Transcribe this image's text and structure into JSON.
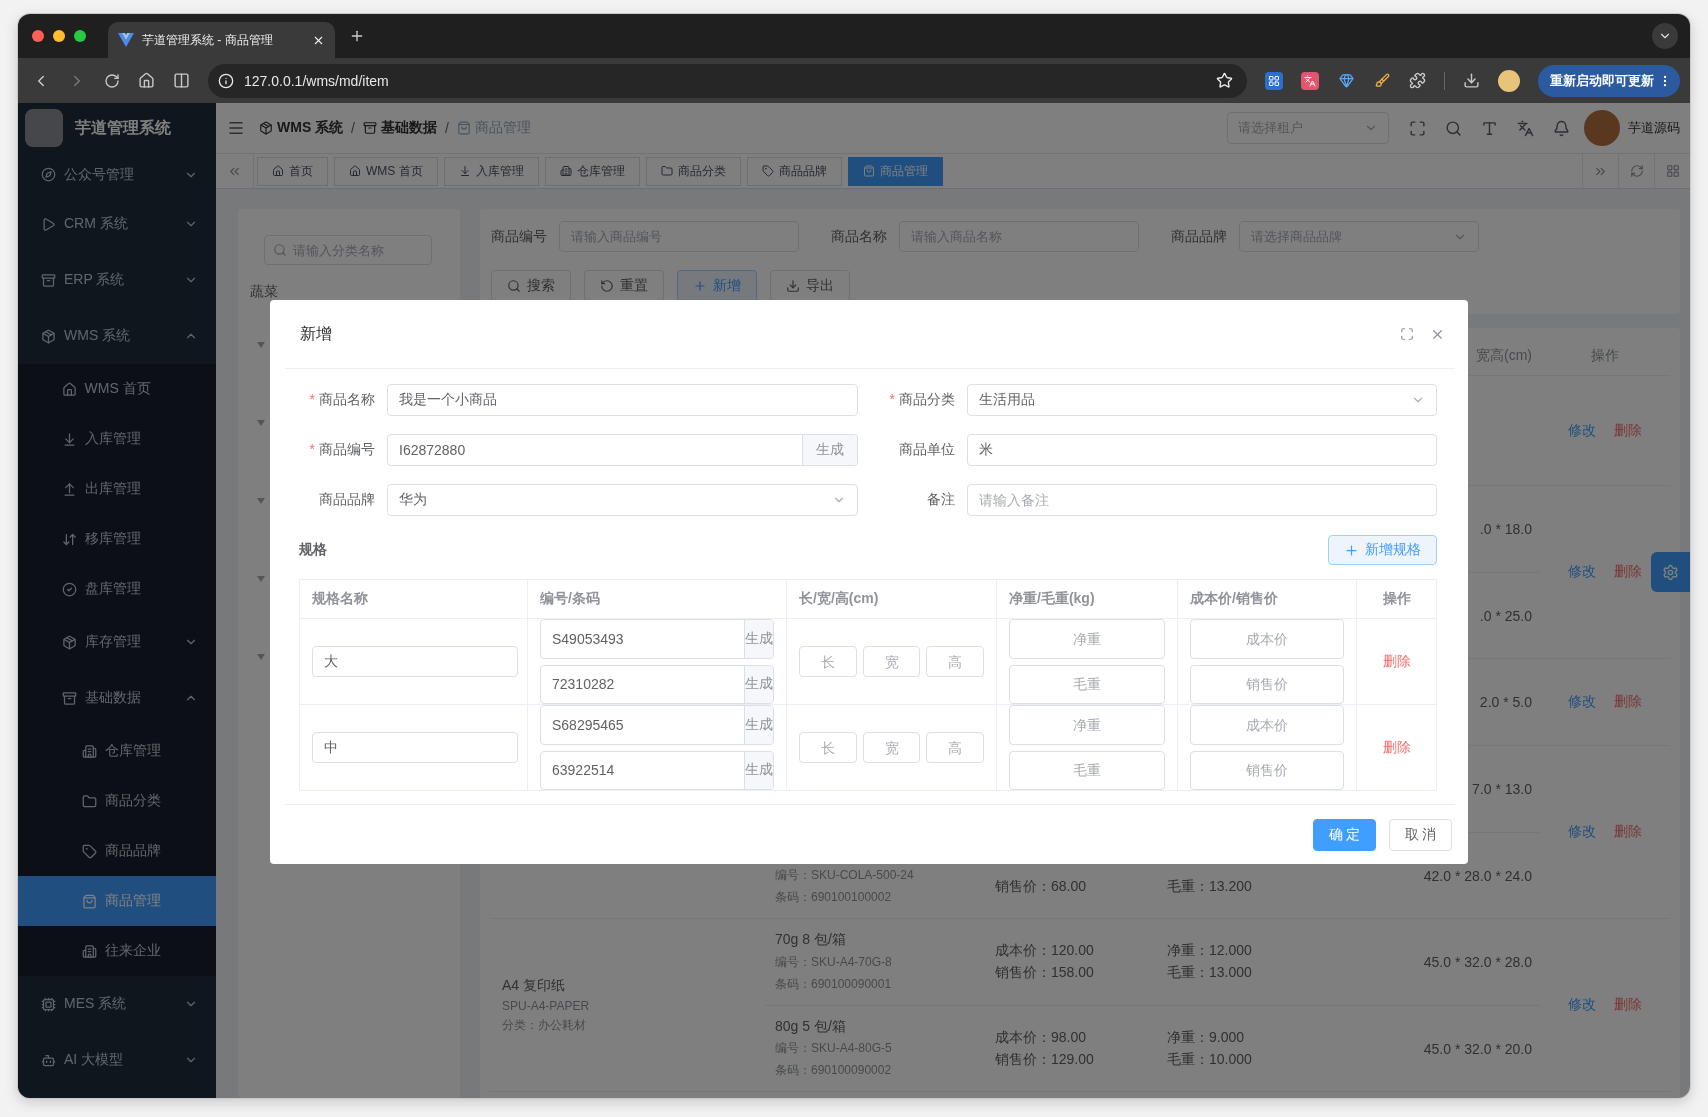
{
  "browser": {
    "tab_title": "芋道管理系统 - 商品管理",
    "url": "127.0.0.1/wms/md/item",
    "update_button": "重新启动即可更新"
  },
  "sidebar": {
    "brand": "芋道管理系统",
    "items": [
      {
        "label": "公众号管理",
        "expanded": false
      },
      {
        "label": "CRM 系统",
        "expanded": false
      },
      {
        "label": "ERP 系统",
        "expanded": false
      },
      {
        "label": "WMS 系统",
        "expanded": true,
        "children": [
          {
            "label": "WMS 首页",
            "selected": false
          },
          {
            "label": "入库管理",
            "selected": false
          },
          {
            "label": "出库管理",
            "selected": false
          },
          {
            "label": "移库管理",
            "selected": false
          },
          {
            "label": "盘库管理",
            "selected": false
          },
          {
            "label": "库存管理",
            "expanded": false
          },
          {
            "label": "基础数据",
            "expanded": true,
            "children": [
              {
                "label": "仓库管理",
                "selected": false
              },
              {
                "label": "商品分类",
                "selected": false
              },
              {
                "label": "商品品牌",
                "selected": false
              },
              {
                "label": "商品管理",
                "selected": true
              },
              {
                "label": "往来企业",
                "selected": false
              }
            ]
          }
        ]
      },
      {
        "label": "MES 系统",
        "expanded": false
      },
      {
        "label": "AI 大模型",
        "expanded": false
      }
    ]
  },
  "header": {
    "breadcrumb": [
      "WMS 系统",
      "基础数据",
      "商品管理"
    ],
    "separator": "/",
    "tenant_placeholder": "请选择租户",
    "user": "芋道源码"
  },
  "tabs": [
    {
      "label": "首页",
      "selected": false
    },
    {
      "label": "WMS 首页",
      "selected": false
    },
    {
      "label": "入库管理",
      "selected": false
    },
    {
      "label": "仓库管理",
      "selected": false
    },
    {
      "label": "商品分类",
      "selected": false
    },
    {
      "label": "商品品牌",
      "selected": false
    },
    {
      "label": "商品管理",
      "selected": true
    }
  ],
  "category_panel": {
    "search_placeholder": "请输入分类名称",
    "first_node": "蔬菜"
  },
  "filters": [
    {
      "label": "商品编号",
      "kind": "input",
      "placeholder": "请输入商品编号"
    },
    {
      "label": "商品名称",
      "kind": "input",
      "placeholder": "请输入商品名称"
    },
    {
      "label": "商品品牌",
      "kind": "select",
      "placeholder": "请选择商品品牌"
    }
  ],
  "toolbar": [
    {
      "label": "搜索",
      "kind": "default"
    },
    {
      "label": "重置",
      "kind": "default"
    },
    {
      "label": "新增",
      "kind": "primary"
    },
    {
      "label": "导出",
      "kind": "default"
    }
  ],
  "list": {
    "columns": [
      "宽高(cm)",
      "操作"
    ],
    "groups": [
      {
        "actions": [
          "修改",
          "删除"
        ]
      },
      {
        "rows": [
          {
            "dims": ".0 * 18.0"
          },
          {
            "dims": ".0 * 25.0"
          }
        ],
        "actions": [
          "修改",
          "删除"
        ]
      },
      {
        "rows": [
          {
            "dims": "2.0 * 5.0"
          }
        ],
        "actions": [
          "修改",
          "删除"
        ]
      },
      {
        "rows": [
          {
            "dims": "7.0 * 13.0"
          },
          {
            "code": "编号：SKU-COLA-500-24",
            "barcode": "条码：690100100002",
            "sale": "销售价：68.00",
            "gross": "毛重：13.200",
            "dims": "42.0 * 28.0 * 24.0"
          }
        ],
        "actions": [
          "修改",
          "删除"
        ]
      },
      {
        "product": {
          "name": "A4 复印纸",
          "spu": "SPU-A4-PAPER",
          "category": "分类：办公耗材"
        },
        "rows": [
          {
            "spec": "70g 8 包/箱",
            "code": "编号：SKU-A4-70G-8",
            "barcode": "条码：690100090001",
            "cost": "成本价：120.00",
            "sale": "销售价：158.00",
            "net": "净重：12.000",
            "gross": "毛重：13.000",
            "dims": "45.0 * 32.0 * 28.0"
          },
          {
            "spec": "80g 5 包/箱",
            "code": "编号：SKU-A4-80G-5",
            "barcode": "条码：690100090002",
            "cost": "成本价：98.00",
            "sale": "销售价：129.00",
            "net": "净重：9.000",
            "gross": "毛重：10.000",
            "dims": "45.0 * 32.0 * 20.0"
          }
        ],
        "actions": [
          "修改",
          "删除"
        ]
      }
    ]
  },
  "dialog": {
    "title": "新增",
    "fields": [
      {
        "label": "商品名称",
        "required_mark": "*",
        "kind": "input",
        "value": "我是一个小商品"
      },
      {
        "label": "商品分类",
        "required_mark": "*",
        "kind": "select",
        "value": "生活用品"
      },
      {
        "label": "商品编号",
        "required_mark": "*",
        "kind": "input_button",
        "value": "I62872880",
        "button": "生成"
      },
      {
        "label": "商品单位",
        "kind": "input",
        "value": "米"
      },
      {
        "label": "商品品牌",
        "kind": "select",
        "value": "华为"
      },
      {
        "label": "备注",
        "kind": "input",
        "placeholder": "请输入备注"
      }
    ],
    "spec_title": "规格",
    "add_spec_button": "新增规格",
    "spec_columns": [
      "规格名称",
      "编号/条码",
      "长/宽/高(cm)",
      "净重/毛重(kg)",
      "成本价/销售价",
      "操作"
    ],
    "specs": [
      {
        "name": "大",
        "codes": [
          {
            "value": "S49053493",
            "button": "生成"
          },
          {
            "value": "72310282",
            "button": "生成"
          }
        ],
        "dims": [
          {
            "placeholder": "长"
          },
          {
            "placeholder": "宽"
          },
          {
            "placeholder": "高"
          }
        ],
        "weights": [
          {
            "placeholder": "净重"
          },
          {
            "placeholder": "毛重"
          }
        ],
        "prices": [
          {
            "placeholder": "成本价"
          },
          {
            "placeholder": "销售价"
          }
        ],
        "action": "删除"
      },
      {
        "name": "中",
        "codes": [
          {
            "value": "S68295465",
            "button": "生成"
          },
          {
            "value": "63922514",
            "button": "生成"
          }
        ],
        "dims": [
          {
            "placeholder": "长"
          },
          {
            "placeholder": "宽"
          },
          {
            "placeholder": "高"
          }
        ],
        "weights": [
          {
            "placeholder": "净重"
          },
          {
            "placeholder": "毛重"
          }
        ],
        "prices": [
          {
            "placeholder": "成本价"
          },
          {
            "placeholder": "销售价"
          }
        ],
        "action": "删除"
      }
    ],
    "buttons": [
      {
        "label": "确 定",
        "kind": "primary"
      },
      {
        "label": "取 消",
        "kind": "default"
      }
    ]
  }
}
